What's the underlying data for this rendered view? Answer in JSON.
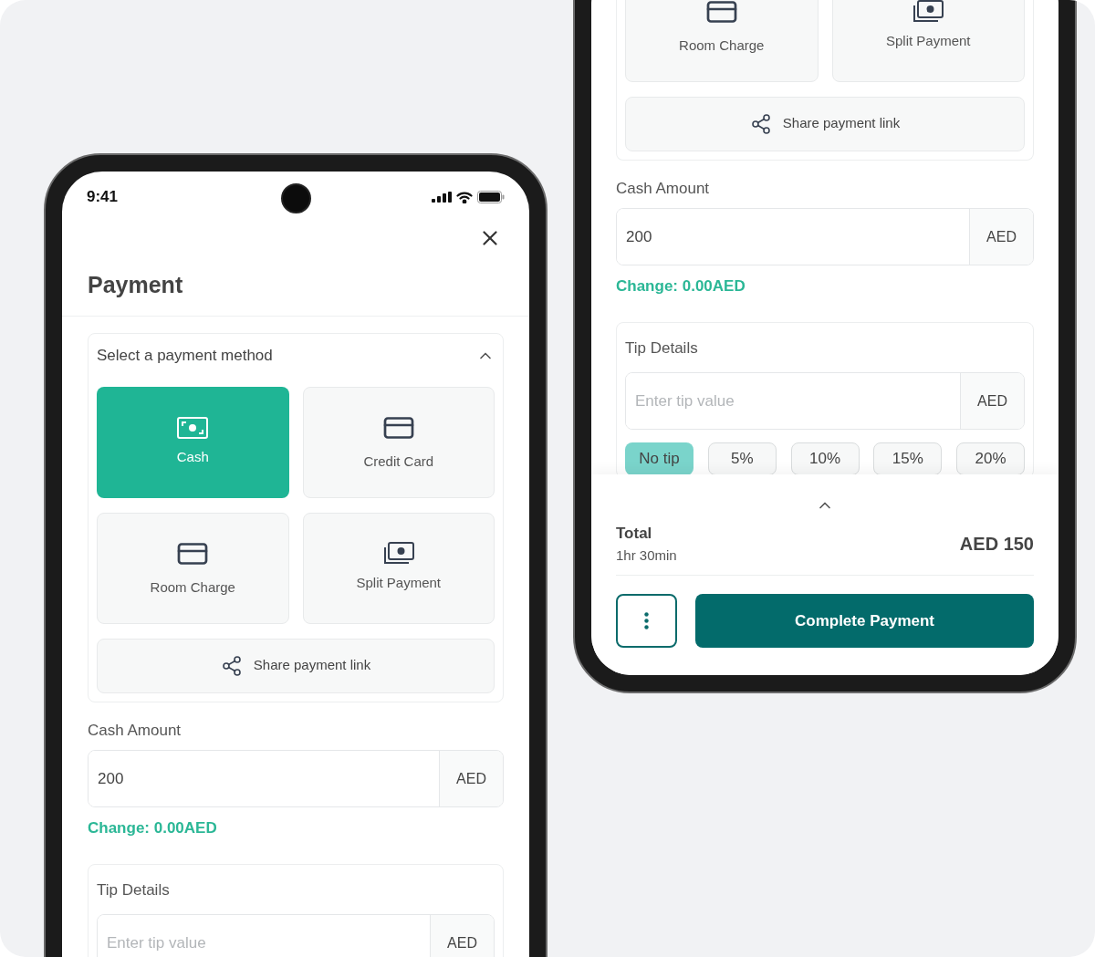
{
  "left_phone": {
    "status_bar": {
      "time": "9:41"
    },
    "title": "Payment",
    "payment_method": {
      "label": "Select a payment method",
      "expanded": true,
      "options": [
        {
          "kind": "cash",
          "label": "Cash",
          "selected": true
        },
        {
          "kind": "card",
          "label": "Credit Card",
          "selected": false
        },
        {
          "kind": "room",
          "label": "Room Charge",
          "selected": false
        },
        {
          "kind": "split",
          "label": "Split Payment",
          "selected": false
        }
      ],
      "share_link": "Share payment link"
    },
    "cash_amount": {
      "label": "Cash Amount",
      "value": "200",
      "currency": "AED"
    },
    "change": "Change: 0.00AED",
    "tip_details": {
      "label": "Tip Details",
      "placeholder": "Enter tip value",
      "currency": "AED"
    }
  },
  "right_phone": {
    "payment_method": {
      "options": [
        {
          "kind": "room",
          "label": "Room Charge",
          "selected": false
        },
        {
          "kind": "split",
          "label": "Split Payment",
          "selected": false
        }
      ],
      "share_link": "Share payment link"
    },
    "cash_amount": {
      "label": "Cash Amount",
      "value": "200",
      "currency": "AED"
    },
    "change": "Change: 0.00AED",
    "tip_details": {
      "label": "Tip Details",
      "placeholder": "Enter tip value",
      "currency": "AED",
      "options": [
        {
          "label": "No tip",
          "selected": true
        },
        {
          "label": "5%",
          "selected": false
        },
        {
          "label": "10%",
          "selected": false
        },
        {
          "label": "15%",
          "selected": false
        },
        {
          "label": "20%",
          "selected": false
        }
      ]
    },
    "summary": {
      "label": "Total",
      "duration": "1hr 30min",
      "amount": "AED 150"
    },
    "primary_action": "Complete Payment"
  }
}
